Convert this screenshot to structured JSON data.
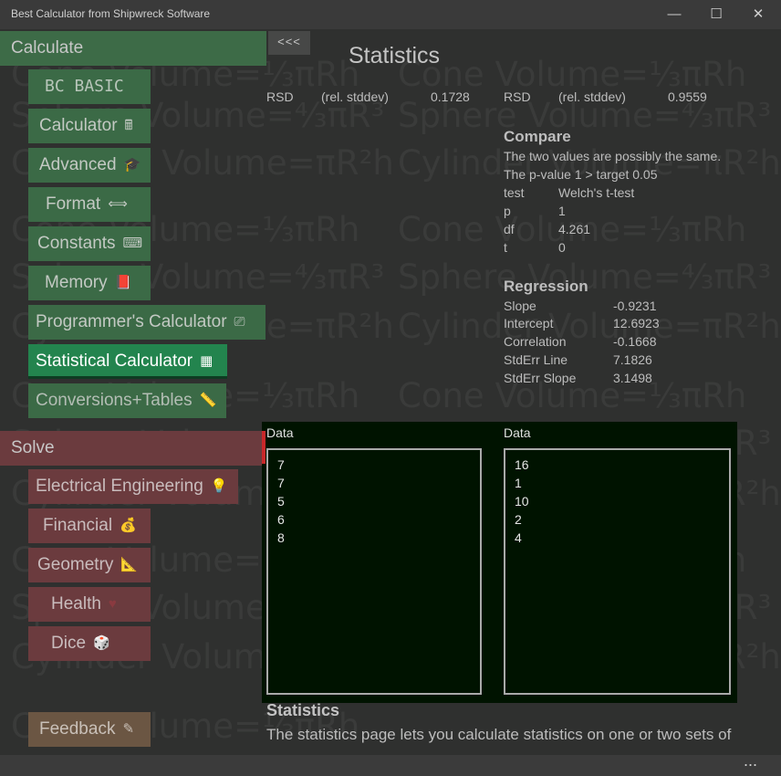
{
  "window": {
    "title": "Best Calculator from Shipwreck Software",
    "minimize": "—",
    "maximize": "☐",
    "close": "✕"
  },
  "watermark": {
    "cone": "Cone Volume=⅓πRh",
    "sphere": "Sphere Volume=⁴⁄₃πR³",
    "cylinder": "Cylinder Volume=πR²h"
  },
  "nav": {
    "calculate_header": "Calculate",
    "solve_header": "Solve",
    "calculate_items": [
      {
        "label": "BC BASIC",
        "icon": ""
      },
      {
        "label": "Calculator",
        "icon": "🖩"
      },
      {
        "label": "Advanced",
        "icon": "🎓"
      },
      {
        "label": "Format",
        "icon": "⟺"
      },
      {
        "label": "Constants",
        "icon": "⌨"
      },
      {
        "label": "Memory",
        "icon": "📕"
      },
      {
        "label": "Programmer's Calculator",
        "icon": "⎚"
      },
      {
        "label": "Statistical Calculator",
        "icon": "▦"
      },
      {
        "label": "Conversions+Tables",
        "icon": "📏"
      }
    ],
    "solve_items": [
      {
        "label": "Electrical Engineering",
        "icon": "💡"
      },
      {
        "label": "Financial",
        "icon": "💰"
      },
      {
        "label": "Geometry",
        "icon": "📐"
      },
      {
        "label": "Health",
        "icon": "♥"
      },
      {
        "label": "Dice",
        "icon": "🎲"
      }
    ],
    "feedback": {
      "label": "Feedback",
      "icon": "✎"
    }
  },
  "back_button": "<<<",
  "page_title": "Statistics",
  "rsd": {
    "left": {
      "label": "RSD",
      "desc": "(rel. stddev)",
      "value": "0.1728"
    },
    "right": {
      "label": "RSD",
      "desc": "(rel. stddev)",
      "value": "0.9559"
    }
  },
  "compare": {
    "title": "Compare",
    "line1": "The two values are possibly the same.",
    "line2": "The p-value 1 > target 0.05",
    "rows": [
      {
        "k": "test",
        "v": "Welch's t-test"
      },
      {
        "k": "p",
        "v": "1"
      },
      {
        "k": "df",
        "v": "4.261"
      },
      {
        "k": "t",
        "v": "0"
      }
    ]
  },
  "regression": {
    "title": "Regression",
    "rows": [
      {
        "k": "Slope",
        "v": "-0.9231"
      },
      {
        "k": "Intercept",
        "v": "12.6923"
      },
      {
        "k": "Correlation",
        "v": "-0.1668"
      },
      {
        "k": "StdErr Line",
        "v": "7.1826"
      },
      {
        "k": "StdErr Slope",
        "v": "3.1498"
      }
    ]
  },
  "data": {
    "left": {
      "label": "Data",
      "values": [
        "7",
        "7",
        "5",
        "6",
        "8"
      ]
    },
    "right": {
      "label": "Data",
      "values": [
        "16",
        "1",
        "10",
        "2",
        "4"
      ]
    }
  },
  "description": {
    "title": "Statistics",
    "text": "The statistics page lets you calculate statistics on one or two sets of"
  },
  "statusbar": {
    "more": "..."
  },
  "colors": {
    "background": "#2f302f",
    "calculate_green": "#3d6b47",
    "selected_green": "#23844e",
    "solve_red": "#6b3b3e",
    "feedback_orange": "#6b5643",
    "data_panel": "#001300"
  }
}
